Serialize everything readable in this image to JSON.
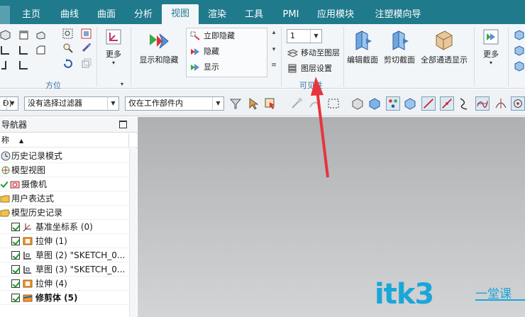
{
  "ribbon_tabs": [
    "主页",
    "曲线",
    "曲面",
    "分析",
    "视图",
    "渲染",
    "工具",
    "PMI",
    "应用模块",
    "注塑模向导"
  ],
  "active_tab": "视图",
  "ribbon": {
    "orient_group_label": "方位",
    "more_label": "更多",
    "show_hide_label": "显示和隐藏",
    "immediate_hide_label": "立即隐藏",
    "hide_label": "隐藏",
    "show_label": "显示",
    "layer_combo_value": "1",
    "move_to_layer_label": "移动至图层",
    "layer_settings_label": "图层设置",
    "visibility_group_label": "可见性",
    "edit_section_label": "编辑截面",
    "clip_section_label": "剪切截面",
    "show_all_label": "全部通透显示",
    "more2_label": "更多"
  },
  "toolbar": {
    "menu_stub": "Ð)",
    "filter_combo_value": "没有选择过滤器",
    "scope_combo_value": "仅在工作部件内"
  },
  "navigator": {
    "title": "导航器",
    "column_header": "称",
    "items": [
      {
        "label": "历史记录模式",
        "icon": "clock-icon"
      },
      {
        "label": "模型视图",
        "icon": "model-view-icon"
      },
      {
        "label": "摄像机",
        "icon": "camera-icon"
      },
      {
        "label": "用户表达式",
        "icon": "folder-icon"
      },
      {
        "label": "模型历史记录",
        "icon": "folder-open-icon"
      },
      {
        "label": "基准坐标系 (0)",
        "icon": "datum-csys-icon"
      },
      {
        "label": "拉伸 (1)",
        "icon": "extrude-icon"
      },
      {
        "label": "草图 (2) \"SKETCH_0...",
        "icon": "sketch-icon"
      },
      {
        "label": "草图 (3) \"SKETCH_0...",
        "icon": "sketch-icon"
      },
      {
        "label": "拉伸 (4)",
        "icon": "extrude-icon"
      },
      {
        "label": "修剪体 (5)",
        "icon": "trim-body-icon"
      }
    ]
  },
  "watermark": {
    "main": "itk3",
    "sub": "一堂课"
  },
  "colors": {
    "accent": "#1f7a8c",
    "arrow": "#e8343c",
    "watermark": "#1aa6d8"
  }
}
